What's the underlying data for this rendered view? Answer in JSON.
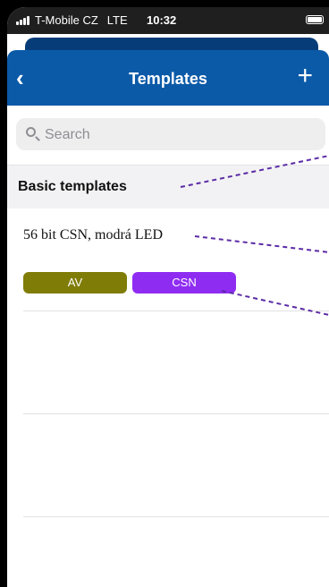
{
  "status_bar": {
    "carrier": "T-Mobile CZ",
    "network": "LTE",
    "time": "10:32"
  },
  "navbar": {
    "title": "Templates",
    "back_icon": "chevron-left-icon",
    "add_icon": "plus-icon"
  },
  "search": {
    "placeholder": "Search",
    "value": ""
  },
  "section": {
    "title": "Basic templates"
  },
  "templates": [
    {
      "name": "56 bit CSN, modrá LED",
      "tags": [
        {
          "label": "AV",
          "color": "#807c08"
        },
        {
          "label": "CSN",
          "color": "#8f2cf2"
        }
      ]
    }
  ],
  "colors": {
    "nav_bar": "#0b5aa8",
    "callout_line": "#5b2aa5",
    "section_bg": "#f2f2f4"
  }
}
